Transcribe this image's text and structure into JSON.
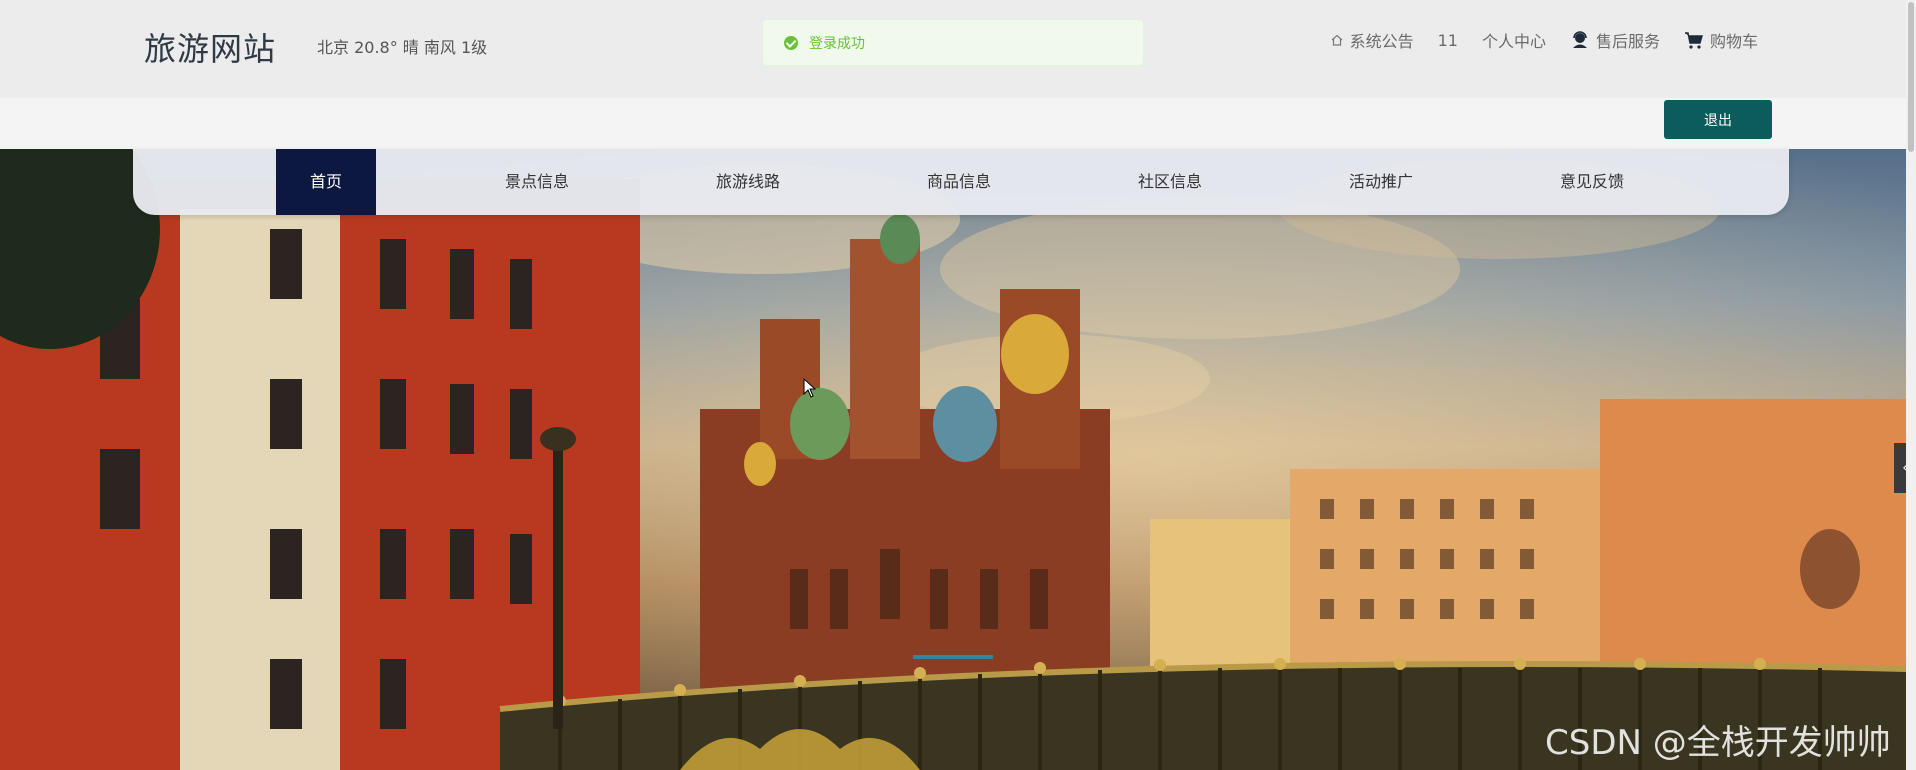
{
  "header": {
    "site_title": "旅游网站",
    "weather": "北京  20.8°  晴  南风  1级"
  },
  "toast": {
    "message": "登录成功",
    "type": "success",
    "color": "#67c23a"
  },
  "top_links": {
    "announcement": "系统公告",
    "count": "11",
    "user_center": "个人中心",
    "after_sales": "售后服务",
    "cart": "购物车"
  },
  "actions": {
    "logout": "退出"
  },
  "nav": {
    "items": [
      {
        "label": "首页",
        "active": true
      },
      {
        "label": "景点信息",
        "active": false
      },
      {
        "label": "旅游线路",
        "active": false
      },
      {
        "label": "商品信息",
        "active": false
      },
      {
        "label": "社区信息",
        "active": false
      },
      {
        "label": "活动推广",
        "active": false
      },
      {
        "label": "意见反馈",
        "active": false
      }
    ]
  },
  "hero": {
    "watermark": "CSDN @全栈开发帅帅"
  },
  "colors": {
    "nav_active": "#0d1840",
    "logout_button": "#0d5c5c",
    "toast_bg": "#f0f9eb"
  }
}
